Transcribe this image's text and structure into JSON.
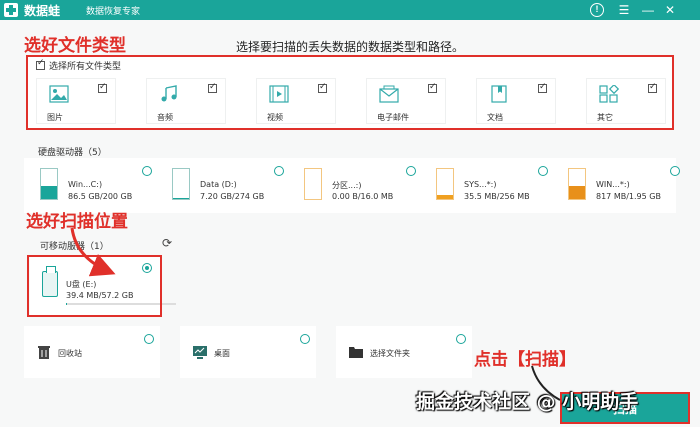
{
  "titlebar": {
    "app_name": "数据蛙",
    "subtitle": "数据恢复专家",
    "icons": [
      "help-icon",
      "menu-icon",
      "minimize-icon",
      "close-icon"
    ],
    "color": "#1aa59a"
  },
  "annotations": {
    "step1": "选好文件类型",
    "step2": "选好扫描位置",
    "step3": "点击【扫描】",
    "color": "#e0302a"
  },
  "instruction": "选择要扫描的丢失数据的数据类型和路径。",
  "file_types": {
    "select_all_label": "选择所有文件类型",
    "select_all_checked": true,
    "items": [
      {
        "label": "图片",
        "icon": "image-icon",
        "checked": true
      },
      {
        "label": "音频",
        "icon": "music-icon",
        "checked": true
      },
      {
        "label": "视频",
        "icon": "video-icon",
        "checked": true
      },
      {
        "label": "电子邮件",
        "icon": "email-icon",
        "checked": true
      },
      {
        "label": "文档",
        "icon": "document-icon",
        "checked": true
      },
      {
        "label": "其它",
        "icon": "other-icon",
        "checked": true
      }
    ]
  },
  "hard_drives": {
    "label": "硬盘驱动器（5）",
    "items": [
      {
        "name": "Win...C:)",
        "size": "86.5 GB/200 GB",
        "fill": 0.43,
        "fill_color": "#1aa59a"
      },
      {
        "name": "Data (D:)",
        "size": "7.20 GB/274 GB",
        "fill": 0.03,
        "fill_color": "#1aa59a"
      },
      {
        "name": "分区...:)",
        "size": "0.00  B/16.0 MB",
        "fill": 0.0,
        "fill_color": "#1aa59a"
      },
      {
        "name": "SYS...*:)",
        "size": "35.5 MB/256 MB",
        "fill": 0.14,
        "fill_color": "#f0a020"
      },
      {
        "name": "WIN...*:)",
        "size": "817 MB/1.95 GB",
        "fill": 0.42,
        "fill_color": "#e8901a"
      }
    ]
  },
  "removable": {
    "label": "可移动服",
    "label_suffix": "器（1）",
    "usb": {
      "name": "U盘 (E:)",
      "size": "39.4 MB/57.2 GB",
      "fill": 0.01,
      "selected": true
    }
  },
  "locations": [
    {
      "label": "回收站",
      "icon": "recycle-bin-icon"
    },
    {
      "label": "桌面",
      "icon": "desktop-icon"
    },
    {
      "label": "选择文件夹",
      "icon": "folder-icon"
    }
  ],
  "scan_button": "扫描",
  "watermark": "掘金技术社区 @ 小明助手"
}
